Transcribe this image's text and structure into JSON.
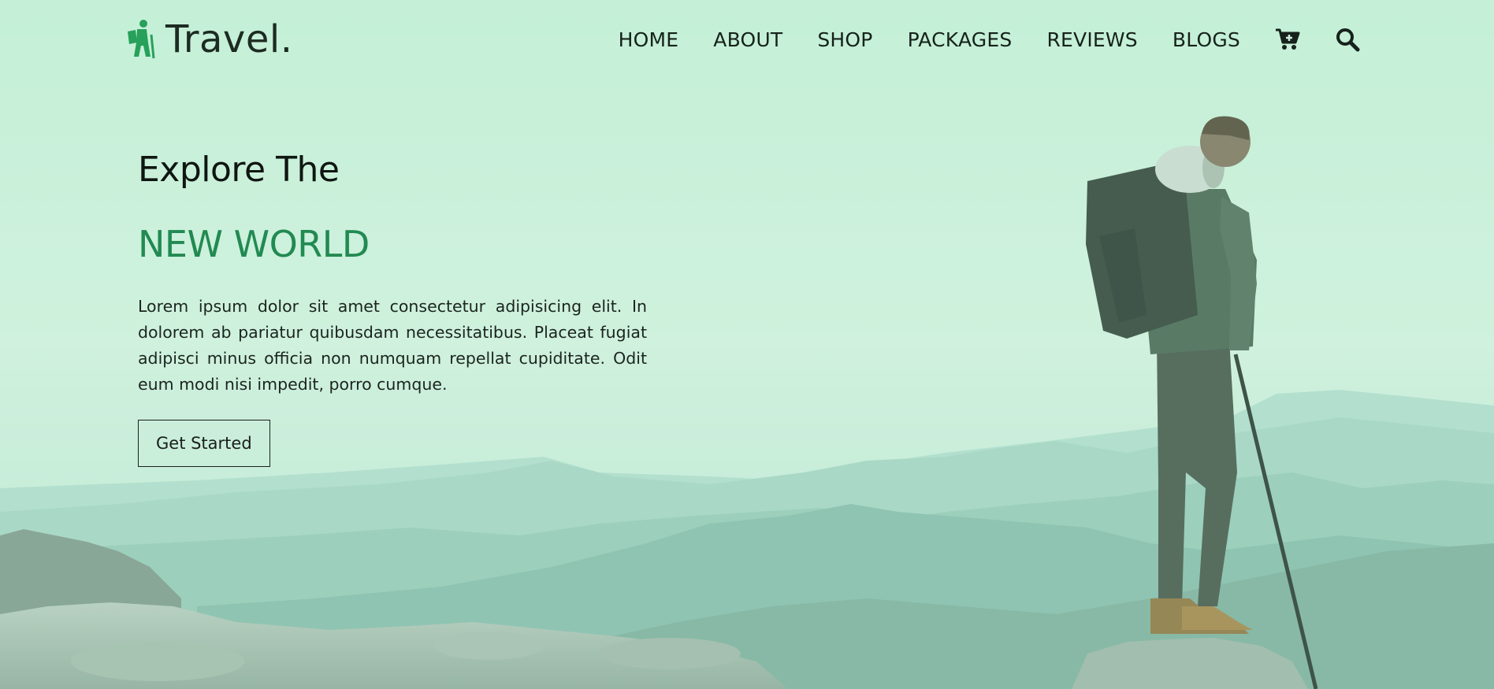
{
  "brand": {
    "name": "Travel.",
    "logo_icon": "hiker-icon",
    "accent_color": "#27a05a"
  },
  "nav": {
    "items": [
      "HOME",
      "ABOUT",
      "SHOP",
      "PACKAGES",
      "REVIEWS",
      "BLOGS"
    ],
    "cart_icon": "cart-icon",
    "search_icon": "search-icon"
  },
  "hero": {
    "title_line1": "Explore The",
    "title_line2": "NEW WORLD",
    "title_line2_color": "#228a52",
    "description": "Lorem ipsum dolor sit amet consectetur adipisicing elit. In dolorem ab pariatur quibusdam necessitatibus. Placeat fugiat adipisci minus officia non numquam repellat cupiditate. Odit eum modi nisi impedit, porro cumque.",
    "cta_label": "Get Started"
  },
  "background": {
    "scene": "hiker standing on rocky summit overlooking mountain ranges",
    "tint_color": "#cdeedd"
  }
}
